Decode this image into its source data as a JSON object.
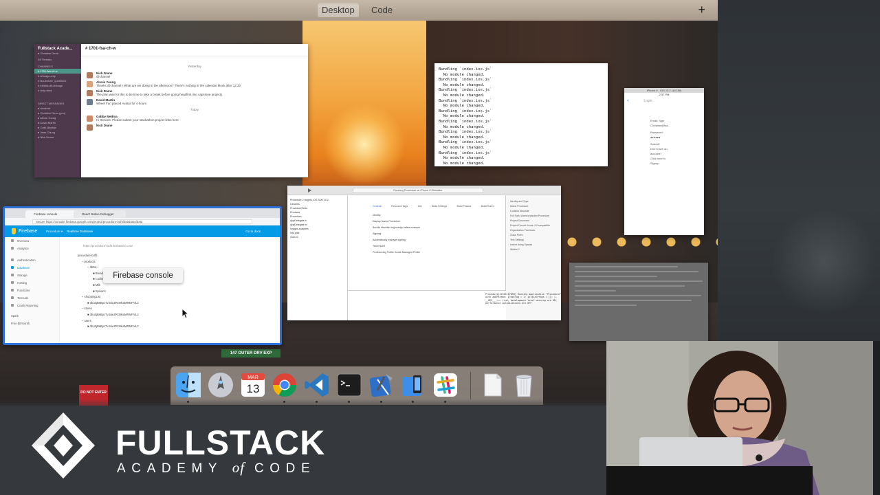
{
  "spaces": {
    "tabs": [
      "Desktop",
      "Code"
    ],
    "active": "Desktop",
    "add_label": "+"
  },
  "slack": {
    "team": "Fullstack Acade...",
    "user": "● Christine Dean",
    "all_threads": "All Threads",
    "channels_header": "CHANNELS",
    "channels": [
      "# 1701-fsa-ch-w",
      "# chicago-only",
      "# fsa-lecture_questions",
      "# fullstck-all-chicago",
      "# help-desk"
    ],
    "dm_header": "DIRECT MESSAGES",
    "dms": [
      "● slackbot",
      "● Christine Dean (you)",
      "● Alexis Young",
      "● David Martin",
      "● Gabi Mankiw",
      "● Jean Chung",
      "● Nick Drane"
    ],
    "channel_title": "# 1701-fsa-ch-w",
    "day_yesterday": "Yesterday",
    "day_today": "Today",
    "messages": [
      {
        "name": "Nick Drane",
        "text": "@channel"
      },
      {
        "name": "Alexis Young",
        "text": "Thanks @channel ! What are we doing in the afternoon? There's nothing in the calendar block after 12:30"
      },
      {
        "name": "Nick Drane",
        "text": "The plan was for this to be time to take a break before going headfirst into capstone projects"
      },
      {
        "name": "David Martin",
        "text": "Wheel Fun placed Avatar for 4 hours"
      },
      {
        "name": "Gabby Medina",
        "text": "Hi Seniors: Please submit your stackathon project links here"
      },
      {
        "name": "Nick Drane",
        "text": ""
      }
    ]
  },
  "terminal": {
    "lines": [
      "Bundling `index.ios.js`",
      "  No module changed.",
      "Bundling `index.ios.js`",
      "  No module changed.",
      "Bundling `index.ios.js`",
      "  No module changed.",
      "Bundling `index.ios.js`",
      "  No module changed.",
      "Bundling `index.ios.js`",
      "  No module changed.",
      "Bundling `index.ios.js`",
      "  No module changed.",
      "Bundling `index.ios.js`",
      "  No module changed.",
      "Bundling `index.ios.js`",
      "  No module changed.",
      "Bundling `index.ios.js`",
      "  No module changed.",
      "  No module changed."
    ]
  },
  "simulator": {
    "status": "iPhone 6 - iOS 10.2 (14C89)",
    "time": "2:37 PM",
    "nav_back": "<",
    "nav_title": "Login",
    "fields": [
      "Email: Sign",
      "Christine@fsa...",
      "Password:",
      "●●●●●●",
      "Submit!",
      "Don't have an",
      "account?",
      "Click here to",
      "Signup"
    ]
  },
  "chrome": {
    "tabs": [
      "Firebase console",
      "React Native Debugger"
    ],
    "url": "Secure  https://console.firebase.google.com/project/procedure-b4f5/database/data",
    "fb_title": "Firebase",
    "project": "Procedure ▾",
    "page": "Realtime Database",
    "docs": "Go to docs",
    "side_items": [
      "Overview",
      "Analytics",
      "Authentication",
      "Database",
      "Storage",
      "Hosting",
      "Functions",
      "Test Lab",
      "Crash Reporting",
      "Spark",
      "Free $0/month"
    ],
    "side_active": "Database",
    "db_url": "https://procedure-b4f5.firebaseio.com/",
    "db_rows": [
      "procedure-b4f5",
      "– products",
      "– 3b0a...",
      "  ■ Bread",
      "  ■ Cookies",
      "  ■ Milk",
      "  ■ Spinach",
      "+ shoppingList",
      "  ■ 3bu3jBsBpcTvJ4ieZRO9kaMRMFAlL2",
      "– stores",
      "  ■ 3bu3jBsBpcTvJ4ieZRO9kaMRMFAlL2",
      "– users",
      "  ■ 3bu3jBsBpcTvJ4ieZRO9kaMRMFAlL2"
    ]
  },
  "tooltip": "Firebase console",
  "xcode": {
    "status": "Running Procedure on iPhone 6 Simulator",
    "nav_items": [
      "Procedure 2 targets, iOS SDK 10.2",
      "Libraries",
      "ProcedureTests",
      "Products",
      "Procedure",
      "AppDelegate.h",
      "AppDelegate.m",
      "Images.xcassets",
      "Info.plist",
      "main.m"
    ],
    "tabs": [
      "General",
      "Resource Tags",
      "Info",
      "Build Settings",
      "Build Phases",
      "Build Rules"
    ],
    "active_tab": "General",
    "rows": [
      "Identity",
      "Display Name  Procedure",
      "Bundle Identifier  org.reactjs.native.example",
      "Signing",
      "Automatically manage signing",
      "Team  None",
      "Provisioning Profile  Xcode Managed Profile"
    ],
    "inspector": [
      "Identity and Type",
      "Name  Procedure",
      "Location  Absolute",
      "Full Path  /Users/chris/dev/Procedure",
      "Project Document",
      "Project Format  Xcode 3.2-compatible",
      "Organization  Facebook",
      "Class Prefix",
      "Text Settings",
      "Indent Using  Spaces",
      "Widths  2"
    ],
    "console": "Procedure[12345:67890] Running application \"Procedure\" with appParams: {rootTag = 1; initialProps = {}; }. __DEV__ === true, development-level warning are ON, performance optimizations are OFF"
  },
  "dock": {
    "apps": [
      "finder-icon",
      "launchpad-icon",
      "calendar-icon",
      "chrome-icon",
      "vscode-icon",
      "terminal-icon",
      "xcode-icon",
      "simulator-icon",
      "slack-icon",
      "documents-icon",
      "trash-icon"
    ],
    "calendar_month": "MAR",
    "calendar_day": "13"
  },
  "banner": {
    "brand_main": "FULLSTACK",
    "brand_sub_1": "ACADEMY",
    "brand_sub_of": "of",
    "brand_sub_2": "CODE"
  },
  "street_sign": "147 OUTER DRV EXP",
  "do_not_enter": "DO NOT ENTER",
  "colors": {
    "firebase_blue": "#039be5",
    "highlight_border": "#2f6fd8",
    "slack_sidebar": "#4d394b",
    "banner_bg": "#35383c"
  }
}
